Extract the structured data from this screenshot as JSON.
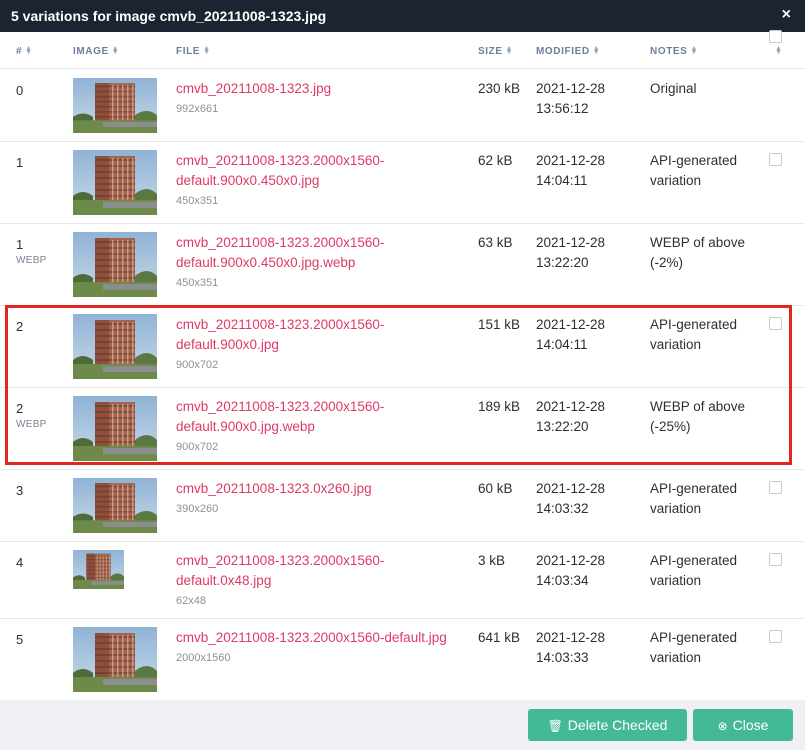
{
  "dialog": {
    "title": "5 variations for image cmvb_20211008-1323.jpg",
    "close_glyph": "×"
  },
  "columns": {
    "num": "#",
    "image": "IMAGE",
    "file": "FILE",
    "size": "SIZE",
    "modified": "MODIFIED",
    "notes": "NOTES"
  },
  "rows": [
    {
      "num": "0",
      "tag": "",
      "file": "cmvb_20211008-1323.jpg",
      "dims": "992x661",
      "size": "230 kB",
      "modified": "2021-12-28 13:56:12",
      "notes": "Original",
      "checkbox": false
    },
    {
      "num": "1",
      "tag": "",
      "file": "cmvb_20211008-1323.2000x1560-default.900x0.450x0.jpg",
      "dims": "450x351",
      "size": "62 kB",
      "modified": "2021-12-28 14:04:11",
      "notes": "API-generated variation",
      "checkbox": true
    },
    {
      "num": "1",
      "tag": "WEBP",
      "file": "cmvb_20211008-1323.2000x1560-default.900x0.450x0.jpg.webp",
      "dims": "450x351",
      "size": "63 kB",
      "modified": "2021-12-28 13:22:20",
      "notes": "WEBP of above (-2%)",
      "checkbox": false
    },
    {
      "num": "2",
      "tag": "",
      "file": "cmvb_20211008-1323.2000x1560-default.900x0.jpg",
      "dims": "900x702",
      "size": "151 kB",
      "modified": "2021-12-28 14:04:11",
      "notes": "API-generated variation",
      "checkbox": true
    },
    {
      "num": "2",
      "tag": "WEBP",
      "file": "cmvb_20211008-1323.2000x1560-default.900x0.jpg.webp",
      "dims": "900x702",
      "size": "189 kB",
      "modified": "2021-12-28 13:22:20",
      "notes": "WEBP of above (-25%)",
      "checkbox": false
    },
    {
      "num": "3",
      "tag": "",
      "file": "cmvb_20211008-1323.0x260.jpg",
      "dims": "390x260",
      "size": "60 kB",
      "modified": "2021-12-28 14:03:32",
      "notes": "API-generated variation",
      "checkbox": true
    },
    {
      "num": "4",
      "tag": "",
      "file": "cmvb_20211008-1323.2000x1560-default.0x48.jpg",
      "dims": "62x48",
      "size": "3 kB",
      "modified": "2021-12-28 14:03:34",
      "notes": "API-generated variation",
      "checkbox": true
    },
    {
      "num": "5",
      "tag": "",
      "file": "cmvb_20211008-1323.2000x1560-default.jpg",
      "dims": "2000x1560",
      "size": "641 kB",
      "modified": "2021-12-28 14:03:33",
      "notes": "API-generated variation",
      "checkbox": true
    }
  ],
  "footer": {
    "delete_label": "Delete Checked",
    "delete_icon": "trash-icon",
    "close_label": "Close",
    "close_icon": "times-circle-icon"
  },
  "colors": {
    "titlebar": "#1c2331",
    "link": "#de3a64",
    "button": "#43b997",
    "highlight": "#e3261d",
    "header_text": "#6f7f99"
  }
}
